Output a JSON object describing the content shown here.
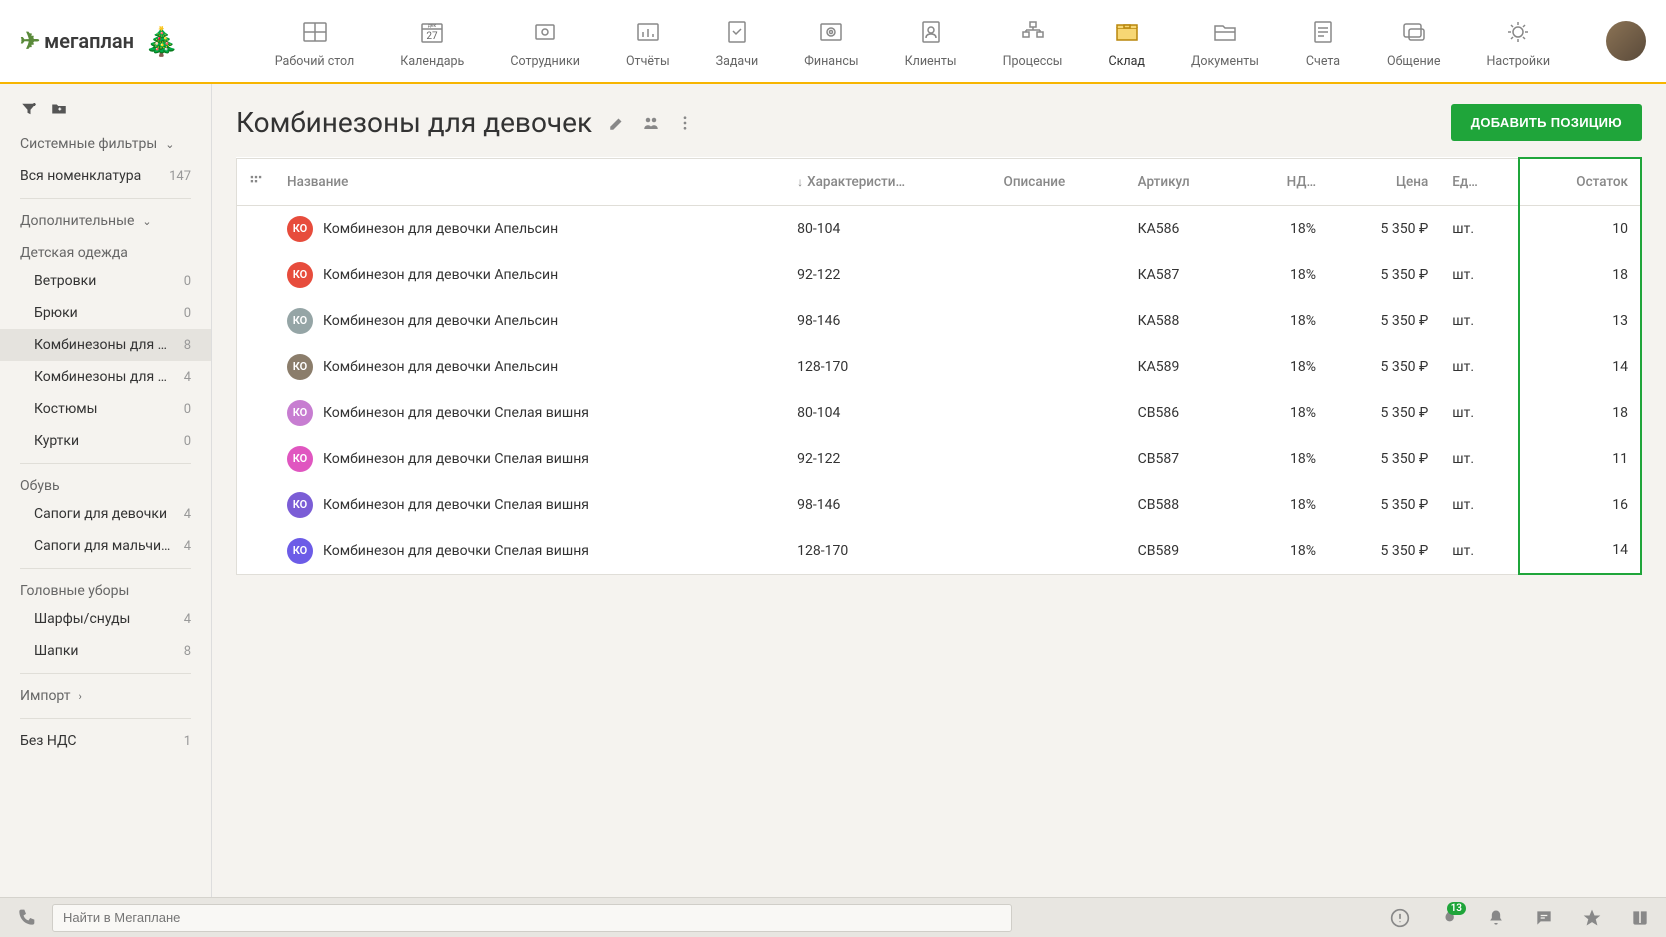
{
  "brand": "мегаплан",
  "nav": [
    {
      "label": "Рабочий стол"
    },
    {
      "label": "Календарь",
      "cal_day": "27",
      "cal_mo": "дек"
    },
    {
      "label": "Сотрудники"
    },
    {
      "label": "Отчёты"
    },
    {
      "label": "Задачи"
    },
    {
      "label": "Финансы"
    },
    {
      "label": "Клиенты"
    },
    {
      "label": "Процессы"
    },
    {
      "label": "Склад",
      "active": true
    },
    {
      "label": "Документы"
    },
    {
      "label": "Счета"
    },
    {
      "label": "Общение"
    },
    {
      "label": "Настройки"
    }
  ],
  "sidebar": {
    "system_filters": "Системные фильтры",
    "all_nomenclature": {
      "label": "Вся номенклатура",
      "count": "147"
    },
    "additional": "Дополнительные",
    "groups": [
      {
        "label": "Детская одежда",
        "items": [
          {
            "label": "Ветровки",
            "count": "0"
          },
          {
            "label": "Брюки",
            "count": "0"
          },
          {
            "label": "Комбинезоны для …",
            "count": "8",
            "active": true
          },
          {
            "label": "Комбинезоны для …",
            "count": "4"
          },
          {
            "label": "Костюмы",
            "count": "0"
          },
          {
            "label": "Куртки",
            "count": "0"
          }
        ]
      },
      {
        "label": "Обувь",
        "items": [
          {
            "label": "Сапоги для девочки",
            "count": "4"
          },
          {
            "label": "Сапоги для мальчи…",
            "count": "4"
          }
        ]
      },
      {
        "label": "Головные уборы",
        "items": [
          {
            "label": "Шарфы/снуды",
            "count": "4"
          },
          {
            "label": "Шапки",
            "count": "8"
          }
        ]
      }
    ],
    "import": "Импорт",
    "no_vat": {
      "label": "Без НДС",
      "count": "1"
    }
  },
  "page": {
    "title": "Комбинезоны для девочек",
    "add_button": "ДОБАВИТЬ ПОЗИЦИЮ"
  },
  "table": {
    "columns": [
      "Название",
      "Характеристи…",
      "Описание",
      "Артикул",
      "НД…",
      "Цена",
      "Ед…",
      "Остаток"
    ],
    "rows": [
      {
        "avatar": "КО",
        "color": "#e74c3c",
        "name": "Комбинезон для девочки Апельсин",
        "char": "80-104",
        "desc": "",
        "sku": "КА586",
        "vat": "18%",
        "price": "5 350 ₽",
        "unit": "шт.",
        "stock": "10"
      },
      {
        "avatar": "КО",
        "color": "#e74c3c",
        "name": "Комбинезон для девочки Апельсин",
        "char": "92-122",
        "desc": "",
        "sku": "КА587",
        "vat": "18%",
        "price": "5 350 ₽",
        "unit": "шт.",
        "stock": "18"
      },
      {
        "avatar": "КО",
        "color": "#95a5a6",
        "name": "Комбинезон для девочки Апельсин",
        "char": "98-146",
        "desc": "",
        "sku": "КА588",
        "vat": "18%",
        "price": "5 350 ₽",
        "unit": "шт.",
        "stock": "13"
      },
      {
        "avatar": "КО",
        "color": "#8b7d6b",
        "name": "Комбинезон для девочки Апельсин",
        "char": "128-170",
        "desc": "",
        "sku": "КА589",
        "vat": "18%",
        "price": "5 350 ₽",
        "unit": "шт.",
        "stock": "14"
      },
      {
        "avatar": "КО",
        "color": "#c77dd1",
        "name": "Комбинезон для девочки Спелая вишня",
        "char": "80-104",
        "desc": "",
        "sku": "СВ586",
        "vat": "18%",
        "price": "5 350 ₽",
        "unit": "шт.",
        "stock": "18"
      },
      {
        "avatar": "КО",
        "color": "#e056c0",
        "name": "Комбинезон для девочки Спелая вишня",
        "char": "92-122",
        "desc": "",
        "sku": "СВ587",
        "vat": "18%",
        "price": "5 350 ₽",
        "unit": "шт.",
        "stock": "11"
      },
      {
        "avatar": "КО",
        "color": "#7b5dd6",
        "name": "Комбинезон для девочки Спелая вишня",
        "char": "98-146",
        "desc": "",
        "sku": "СВ588",
        "vat": "18%",
        "price": "5 350 ₽",
        "unit": "шт.",
        "stock": "16"
      },
      {
        "avatar": "КО",
        "color": "#6c5ce7",
        "name": "Комбинезон для девочки Спелая вишня",
        "char": "128-170",
        "desc": "",
        "sku": "СВ589",
        "vat": "18%",
        "price": "5 350 ₽",
        "unit": "шт.",
        "stock": "14"
      }
    ]
  },
  "footer": {
    "search_placeholder": "Найти в Мегаплане",
    "fire_badge": "13"
  }
}
